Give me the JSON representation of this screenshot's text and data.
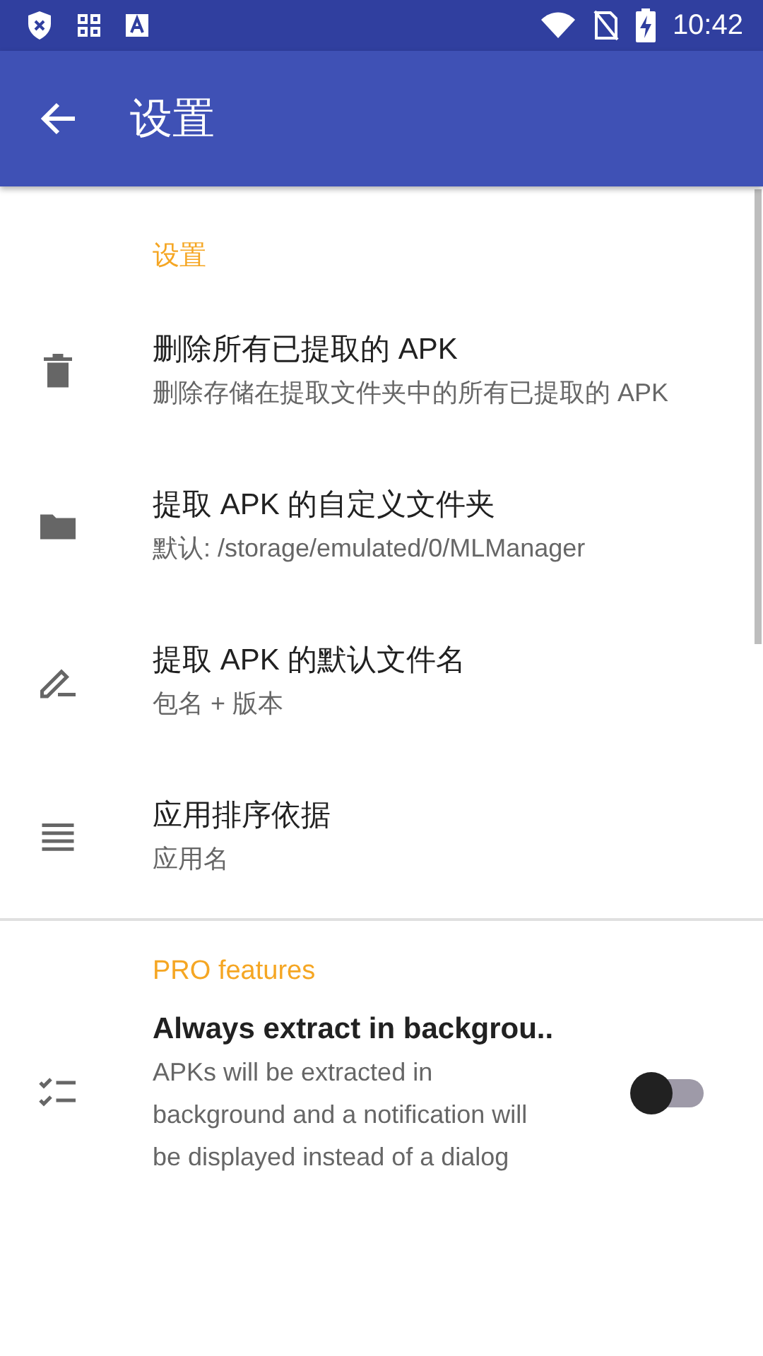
{
  "status_bar": {
    "time": "10:42"
  },
  "toolbar": {
    "title": "设置"
  },
  "sections": [
    {
      "header": "设置",
      "items": [
        {
          "title": "删除所有已提取的 APK",
          "subtitle": "删除存储在提取文件夹中的所有已提取的 APK"
        },
        {
          "title": "提取 APK 的自定义文件夹",
          "subtitle": "默认: /storage/emulated/0/MLManager"
        },
        {
          "title": "提取 APK 的默认文件名",
          "subtitle": "包名 + 版本"
        },
        {
          "title": "应用排序依据",
          "subtitle": "应用名"
        }
      ]
    },
    {
      "header": "PRO features",
      "items": [
        {
          "title": "Always extract in backgrou..",
          "subtitle": "APKs will be extracted in background and a notification will be displayed instead of a dialog",
          "switch": {
            "on": false
          }
        }
      ]
    }
  ]
}
